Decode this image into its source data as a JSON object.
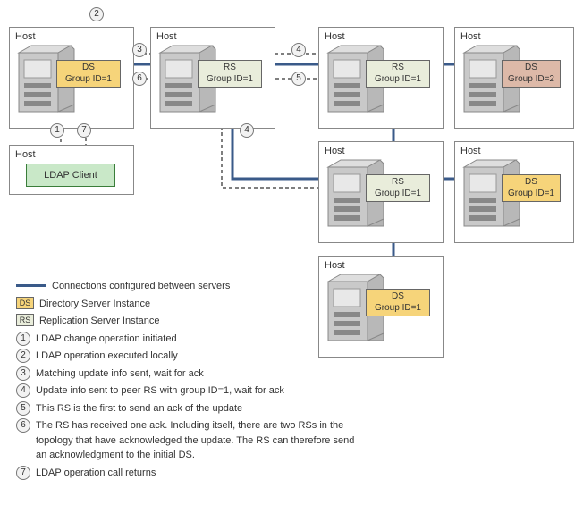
{
  "host_label": "Host",
  "node_lines": {
    "ds_prefix": "DS",
    "rs_prefix": "RS",
    "group_eq": "Group ID="
  },
  "nodes": {
    "ds1": {
      "kind": "DS",
      "group_id": 1,
      "style": "ds-yellow"
    },
    "rs_a": {
      "kind": "RS",
      "group_id": 1,
      "style": "rs"
    },
    "rs_b": {
      "kind": "RS",
      "group_id": 1,
      "style": "rs"
    },
    "ds_g2": {
      "kind": "DS",
      "group_id": 2,
      "style": "ds-purple"
    },
    "rs_c": {
      "kind": "RS",
      "group_id": 1,
      "style": "rs"
    },
    "ds_g1": {
      "kind": "DS",
      "group_id": 1,
      "style": "ds-yellow"
    },
    "ds_bot": {
      "kind": "DS",
      "group_id": 1,
      "style": "ds-yellow"
    }
  },
  "ldap_client_label": "LDAP Client",
  "legend": {
    "conn_line": "Connections configured between servers",
    "ds_instance": "Directory Server Instance",
    "rs_instance": "Replication Server Instance",
    "ds_abbr": "DS",
    "rs_abbr": "RS"
  },
  "steps": {
    "s1": "LDAP change operation initiated",
    "s2": "LDAP operation executed locally",
    "s3": "Matching update info sent, wait for ack",
    "s4": "Update info sent to peer RS with group ID=1, wait for ack",
    "s5": "This RS is the first to send an ack of the update",
    "s6": "The RS has received one ack. Including itself, there are two RSs in the topology that have acknowledged the update. The RS can therefore send an acknowledgment to the initial DS.",
    "s7": "LDAP operation call returns"
  },
  "step_numbers": {
    "n1": "1",
    "n2": "2",
    "n3": "3",
    "n4": "4",
    "n5": "5",
    "n6": "6",
    "n7": "7"
  }
}
